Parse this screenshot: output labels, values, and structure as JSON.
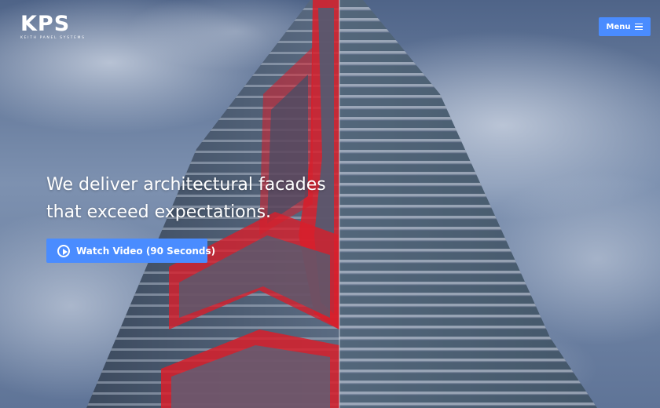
{
  "brand": {
    "logo_text": "KPS",
    "tagline": "KEITH PANEL SYSTEMS"
  },
  "nav": {
    "menu_label": "Menu",
    "menu_icon": "hamburger-icon"
  },
  "hero": {
    "headline_line1": "We deliver architectural facades",
    "headline_line2": "that exceed expectations.",
    "cta_label": "Watch Video (90 Seconds)",
    "cta_icon": "play-circle-icon",
    "background_image": "tower-facade-photo"
  },
  "colors": {
    "accent": "#4a8cff",
    "facade_red": "#d81e2a",
    "sky": "#7c8fae"
  }
}
